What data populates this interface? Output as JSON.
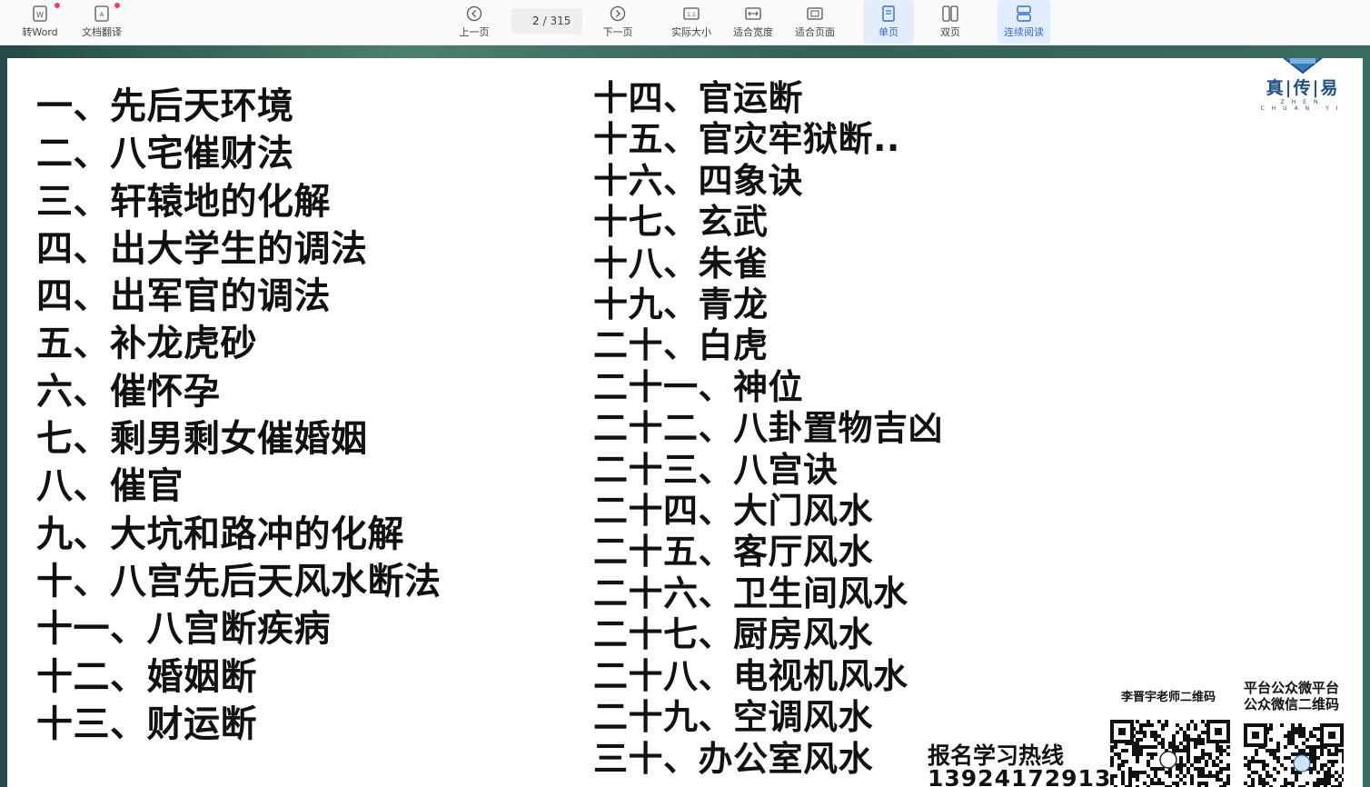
{
  "toolbar": {
    "to_word": "转Word",
    "doc_translate": "文档翻译",
    "prev_page": "上一页",
    "current_page": "2",
    "total_pages": "/ 315",
    "next_page": "下一页",
    "actual_size": "实际大小",
    "fit_width": "适合宽度",
    "fit_page": "适合页面",
    "single_page": "单页",
    "double_page": "双页",
    "continuous": "连续阅读"
  },
  "toc": {
    "left": [
      "一、先后天环境",
      "二、八宅催财法",
      "三、轩辕地的化解",
      "四、出大学生的调法",
      "四、出军官的调法",
      "五、补龙虎砂",
      "六、催怀孕",
      "七、剩男剩女催婚姻",
      "八、催官",
      "九、大坑和路冲的化解",
      "十、八宫先后天风水断法",
      "十一、八宫断疾病",
      "十二、婚姻断",
      "十三、财运断"
    ],
    "right": [
      "十四、官运断",
      "十五、官灾牢狱断..",
      "十六、四象诀",
      "十七、玄武",
      "十八、朱雀",
      "十九、青龙",
      "二十、白虎",
      "二十一、神位",
      "二十二、八卦置物吉凶",
      "二十三、八宫诀",
      "二十四、大门风水",
      "二十五、客厅风水",
      "二十六、卫生间风水",
      "二十七、厨房风水",
      "二十八、电视机风水",
      "二十九、空调风水",
      "三十、办公室风水"
    ]
  },
  "logo": {
    "text": "真|传|易",
    "sub": "ZHEN CHUAN YI"
  },
  "contact": {
    "teacher_qr_label": "李晋宇老师二维码",
    "platform_qr_label_1": "平台公众微平台",
    "platform_qr_label_2": "公众微信二维码",
    "hotline_title": "报名学习热线",
    "hotline_phone": "13924172913"
  }
}
